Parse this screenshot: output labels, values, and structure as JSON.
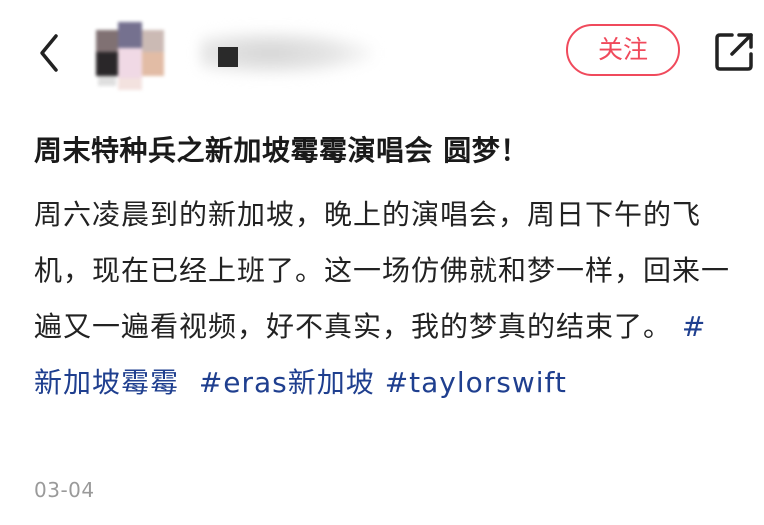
{
  "header": {
    "back_icon": "chevron-left-icon",
    "follow_label": "关注",
    "share_icon": "share-external-icon",
    "accent_color": "#f04a5c"
  },
  "post": {
    "title": "周末特种兵之新加坡霉霉演唱会 圆梦！",
    "body_text": "周六凌晨到的新加坡，晚上的演唱会，周日下午的飞机，现在已经上班了。这一场仿佛就和梦一样，回来一遍又一遍看视频，好不真实，我的梦真的结束了。",
    "hashtags": [
      "#新加坡霉霉",
      "#eras新加坡",
      "#taylorswift"
    ],
    "hashtag_color": "#1f3f8f",
    "date": "03-04"
  }
}
